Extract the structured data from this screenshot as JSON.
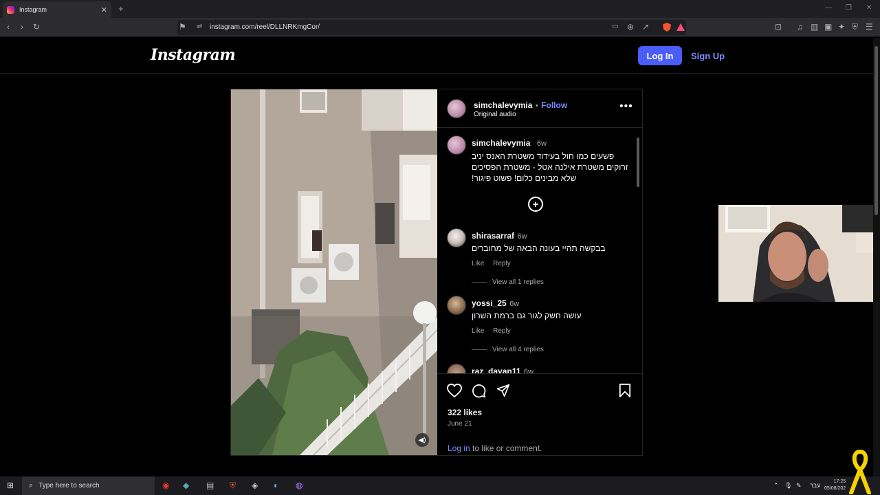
{
  "browser": {
    "tab_title": "Instagram",
    "new_tab": "+",
    "url": "instagram.com/reel/DLLNRKmgCor/"
  },
  "header": {
    "logo": "Instagram",
    "login_label": "Log In",
    "signup_label": "Sign Up"
  },
  "post": {
    "author": "simchalevymia",
    "separator": "•",
    "follow_label": "Follow",
    "audio": "Original audio",
    "more": "•••",
    "caption": {
      "user": "simchalevymia",
      "time": "6w",
      "text": "פשעים כמו חול בעידוד משטרת האנס יניב זרוקים משטרת אילנה אטל - משטרת הפסיכים שלא מבינים כלום! פשוט פיגור!"
    },
    "comments": [
      {
        "user": "shirasarraf",
        "time": "6w",
        "text": "בבקשה תהיי בעונה הבאה של מחוברים",
        "like": "Like",
        "reply": "Reply",
        "view_replies": "View all 1 replies"
      },
      {
        "user": "yossi_25",
        "time": "6w",
        "text": "עושה חשק לגור גם ברמת השרון",
        "like": "Like",
        "reply": "Reply",
        "view_replies": "View all 4 replies"
      },
      {
        "user": "raz_dayan11",
        "time": "6w"
      }
    ],
    "likes": "322 likes",
    "date": "June 21",
    "login_link": "Log in",
    "login_rest": " to like or comment."
  },
  "taskbar": {
    "search_placeholder": "Type here to search",
    "language": "עבר",
    "time": "17:25",
    "date": "05/08/202"
  },
  "icons": [
    "back-icon",
    "forward-icon",
    "reload-icon",
    "bookmark-icon",
    "site-info-icon",
    "cast-icon",
    "zoom-icon",
    "share-icon",
    "brave-shield-icon",
    "rewards-icon",
    "heart-icon",
    "comment-icon",
    "send-icon",
    "save-icon",
    "add-comment-icon",
    "volume-icon",
    "windows-start-icon",
    "search-icon"
  ],
  "colors": {
    "accent": "#4a5df9",
    "link": "#7b8cff",
    "brave": "#fb542b"
  }
}
